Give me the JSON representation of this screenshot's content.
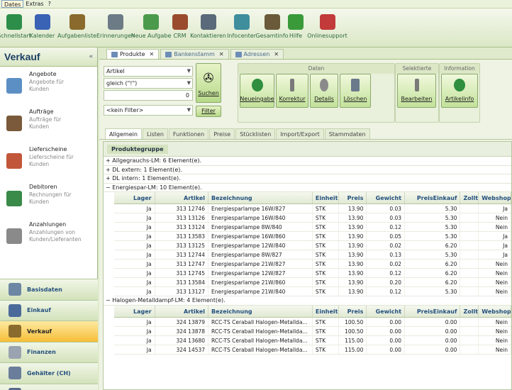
{
  "menu": [
    "Dates",
    "Extras",
    "?"
  ],
  "toolbar": [
    {
      "label": "Schnellstart",
      "icon": "quickstart-icon",
      "color": "#2d8e4a"
    },
    {
      "label": "Kalender",
      "icon": "calendar-icon",
      "color": "#3a63b5"
    },
    {
      "label": "Aufgabenliste",
      "icon": "tasklist-icon",
      "color": "#8a6b2d"
    },
    {
      "label": "Erinnerungen",
      "icon": "clock-icon",
      "color": "#6d7b87"
    },
    {
      "label": "Neue Aufgabe",
      "icon": "new-task-icon",
      "color": "#4b9a4b"
    },
    {
      "label": "CRM",
      "icon": "crm-icon",
      "color": "#9a4b2d"
    },
    {
      "label": "Kontaktieren",
      "icon": "phone-icon",
      "color": "#5a6a7a"
    },
    {
      "label": "Infocenter",
      "icon": "infocenter-icon",
      "color": "#3e8e9e"
    },
    {
      "label": "Gesamtinfo",
      "icon": "overview-icon",
      "color": "#6a5a3a"
    },
    {
      "label": "Hilfe",
      "icon": "help-icon",
      "color": "#3a9a3a"
    },
    {
      "label": "Onlinesupport",
      "icon": "support-icon",
      "color": "#c23a3a"
    }
  ],
  "sidebar": {
    "title": "Verkauf",
    "collapse": "«",
    "items": [
      {
        "title": "Angebote",
        "sub1": "Angebote für",
        "sub2": "Kunden",
        "color": "#5c8fc4"
      },
      {
        "title": "Aufträge",
        "sub1": "Aufträge für",
        "sub2": "Kunden",
        "color": "#7a5a3a"
      },
      {
        "title": "Lieferscheine",
        "sub1": "Lieferscheine für",
        "sub2": "Kunden",
        "color": "#c2563a"
      },
      {
        "title": "Debitoren",
        "sub1": "Rechnungen für",
        "sub2": "Kunden",
        "color": "#3a8a4a"
      },
      {
        "title": "Anzahlungen",
        "sub1": "Anzahlungen von",
        "sub2": "Kunden/Lieferanten",
        "color": "#8a8a8a"
      }
    ],
    "nav": [
      {
        "label": "Basisdaten",
        "color": "#6d86a4",
        "selected": false
      },
      {
        "label": "Einkauf",
        "color": "#4a6a9a",
        "selected": false
      },
      {
        "label": "Verkauf",
        "color": "#8a6b2d",
        "selected": true
      },
      {
        "label": "Finanzen",
        "color": "#9aa4b0",
        "selected": false
      },
      {
        "label": "Gehälter (CH)",
        "color": "#6a7d9a",
        "selected": false
      },
      {
        "label": "DIM",
        "color": "#5a6a8a",
        "selected": false
      }
    ]
  },
  "tabs": [
    {
      "label": "Produkte",
      "active": true
    },
    {
      "label": "Bankenstamm",
      "active": false
    },
    {
      "label": "Adressen",
      "active": false
    }
  ],
  "filter": {
    "field1": "Artikel",
    "field2": "gleich (\"!\")",
    "field3": "0",
    "field4": "<kein Filter>",
    "search": "Suchen",
    "filter": "Filter"
  },
  "groups": {
    "daten": "Daten",
    "selektierte": "Selektierte",
    "information": "Information"
  },
  "ribbon_buttons": {
    "neueingabe": "Neueingabe",
    "korrektur": "Korrektur",
    "details": "Details",
    "loeschen": "Löschen",
    "bearbeiten": "Bearbeiten",
    "artikelinfo": "Artikelinfo"
  },
  "subtabs": [
    "Allgemein",
    "Listen",
    "Funktionen",
    "Preise",
    "Stücklisten",
    "Import/Export",
    "Stammdaten"
  ],
  "grid": {
    "group_header": "Produktegruppe",
    "groups_collapsed": [
      "+ Allgegrauchs-LM: 6 Element(e).",
      "+ DL extern: 1 Element(e).",
      "+ DL intern: 1 Element(e)."
    ],
    "group1": "− Energiespar-LM: 10 Element(e).",
    "group2": "− Halogen-Metalldampf-LM: 4 Element(e).",
    "columns": [
      "Lager",
      "Artikel",
      "Bezeichnung",
      "Einheit",
      "Preis",
      "Gewicht",
      "PreisEinkauf",
      "Zollta",
      "Webshop"
    ],
    "rows1": [
      [
        "Ja",
        "313 12746",
        "Energiesparlampe 16W/827",
        "STK",
        "13.90",
        "0.03",
        "5.30",
        "",
        "Ja"
      ],
      [
        "Ja",
        "313 13126",
        "Energiesparlampe 16W/840",
        "STK",
        "13.90",
        "0.03",
        "5.30",
        "",
        "Nein"
      ],
      [
        "Ja",
        "313 13124",
        "Energiesparlampe 8W/840",
        "STK",
        "13.90",
        "0.12",
        "5.30",
        "",
        "Nein"
      ],
      [
        "Ja",
        "313 13583",
        "Energiesparlampe 16W/860",
        "STK",
        "13.90",
        "0.05",
        "5.30",
        "",
        "Ja"
      ],
      [
        "Ja",
        "313 13125",
        "Energiesparlampe 12W/840",
        "STK",
        "13.90",
        "0.02",
        "6.20",
        "",
        "Ja"
      ],
      [
        "Ja",
        "313 12744",
        "Energiesparlampe 8W/827",
        "STK",
        "13.90",
        "0.13",
        "5.30",
        "",
        "Ja"
      ],
      [
        "Ja",
        "313 12747",
        "Energiesparlampe 21W/827",
        "STK",
        "13.90",
        "0.02",
        "6.20",
        "",
        "Nein"
      ],
      [
        "Ja",
        "313 12745",
        "Energiesparlampe 12W/827",
        "STK",
        "13.90",
        "0.12",
        "6.20",
        "",
        "Nein"
      ],
      [
        "Ja",
        "313 13584",
        "Energiesparlampe 21W/860",
        "STK",
        "13.90",
        "0.20",
        "6.20",
        "",
        "Nein"
      ],
      [
        "Ja",
        "313 13127",
        "Energiesparlampe 21W/840",
        "STK",
        "13.90",
        "0.12",
        "5.30",
        "",
        "Nein"
      ]
    ],
    "rows2": [
      [
        "Ja",
        "324 13879",
        "RCC-TS Ceraball Halogen-Metallda...",
        "STK",
        "100.50",
        "0.00",
        "0.00",
        "",
        "Nein"
      ],
      [
        "Ja",
        "324 13878",
        "RCC-TS Ceraball Halogen-Metallda...",
        "STK",
        "100.50",
        "0.00",
        "0.00",
        "",
        "Nein"
      ],
      [
        "Ja",
        "324 13680",
        "RCC-TS Ceraball Halogen-Metallda...",
        "STK",
        "115.00",
        "0.00",
        "0.00",
        "",
        "Nein"
      ],
      [
        "Ja",
        "324 14537",
        "RCC-TS Ceraball Halogen-Metallda...",
        "STK",
        "115.00",
        "0.00",
        "0.00",
        "",
        "Nein"
      ]
    ]
  }
}
